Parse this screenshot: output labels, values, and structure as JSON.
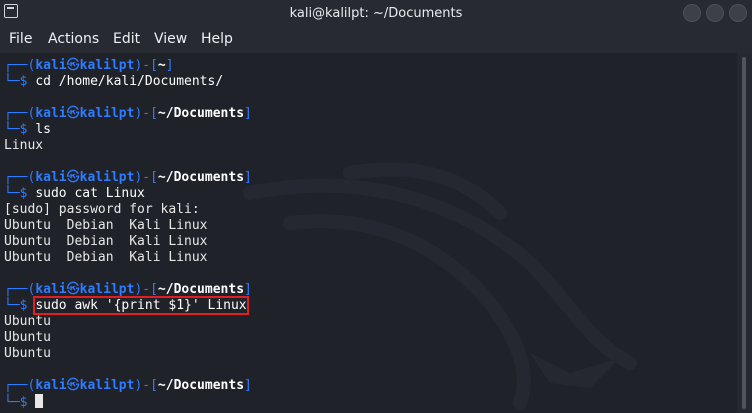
{
  "window": {
    "title": "kali@kalilpt: ~/Documents"
  },
  "menu": {
    "file": "File",
    "actions": "Actions",
    "edit": "Edit",
    "view": "View",
    "help": "Help"
  },
  "prompt": {
    "user": "kali",
    "host": "kalilpt",
    "sep": "㉿",
    "dollar": "$"
  },
  "terminal": {
    "p1_path": "~",
    "p1_cmd": "cd /home/kali/Documents/",
    "p2_path": "~/Documents",
    "p2_cmd": "ls",
    "o2_1": "Linux",
    "p3_path": "~/Documents",
    "p3_cmd": "sudo cat Linux",
    "o3_1": "[sudo] password for kali:",
    "o3_2": "Ubuntu  Debian  Kali Linux",
    "o3_3": "Ubuntu  Debian  Kali Linux",
    "o3_4": "Ubuntu  Debian  Kali Linux",
    "p4_path": "~/Documents",
    "p4_cmd": "sudo awk '{print $1}' Linux",
    "o4_1": "Ubuntu",
    "o4_2": "Ubuntu",
    "o4_3": "Ubuntu",
    "p5_path": "~/Documents"
  },
  "colors": {
    "accent": "#2f7bff",
    "highlight": "#e02020"
  }
}
